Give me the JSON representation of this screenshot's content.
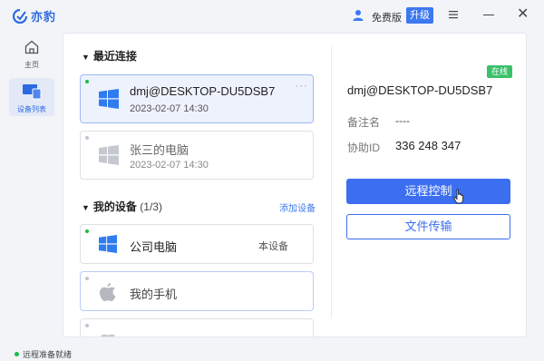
{
  "app": {
    "logo_text": "亦豹"
  },
  "header": {
    "plan_label": "免费版",
    "upgrade_label": "升级"
  },
  "nav": {
    "home_label": "主页",
    "devices_label": "设备列表"
  },
  "recent": {
    "title": "最近连接",
    "items": [
      {
        "name": "dmj@DESKTOP-DU5DSB7",
        "date": "2023-02-07  14:30",
        "online": true,
        "more": "···"
      },
      {
        "name": "张三的电脑",
        "date": "2023-02-07  14:30",
        "online": false
      }
    ]
  },
  "my_devices": {
    "title": "我的设备",
    "count": "(1/3)",
    "add_label": "添加设备",
    "items": [
      {
        "name": "公司电脑",
        "tag": "本设备",
        "online": true
      },
      {
        "name": "我的手机",
        "online": false
      },
      {
        "name": "",
        "online": false
      }
    ]
  },
  "detail": {
    "status_badge": "在线",
    "device_name": "dmj@DESKTOP-DU5DSB7",
    "remark_label": "备注名",
    "remark_value": "----",
    "id_label": "协助ID",
    "id_value": "336 248 347",
    "remote_button": "远程控制",
    "file_button": "文件传输"
  },
  "status_bar": {
    "text": "远程准备就绪"
  },
  "colors": {
    "accent": "#3c6ef0",
    "online": "#1fba3f",
    "badge": "#3cc06b"
  }
}
